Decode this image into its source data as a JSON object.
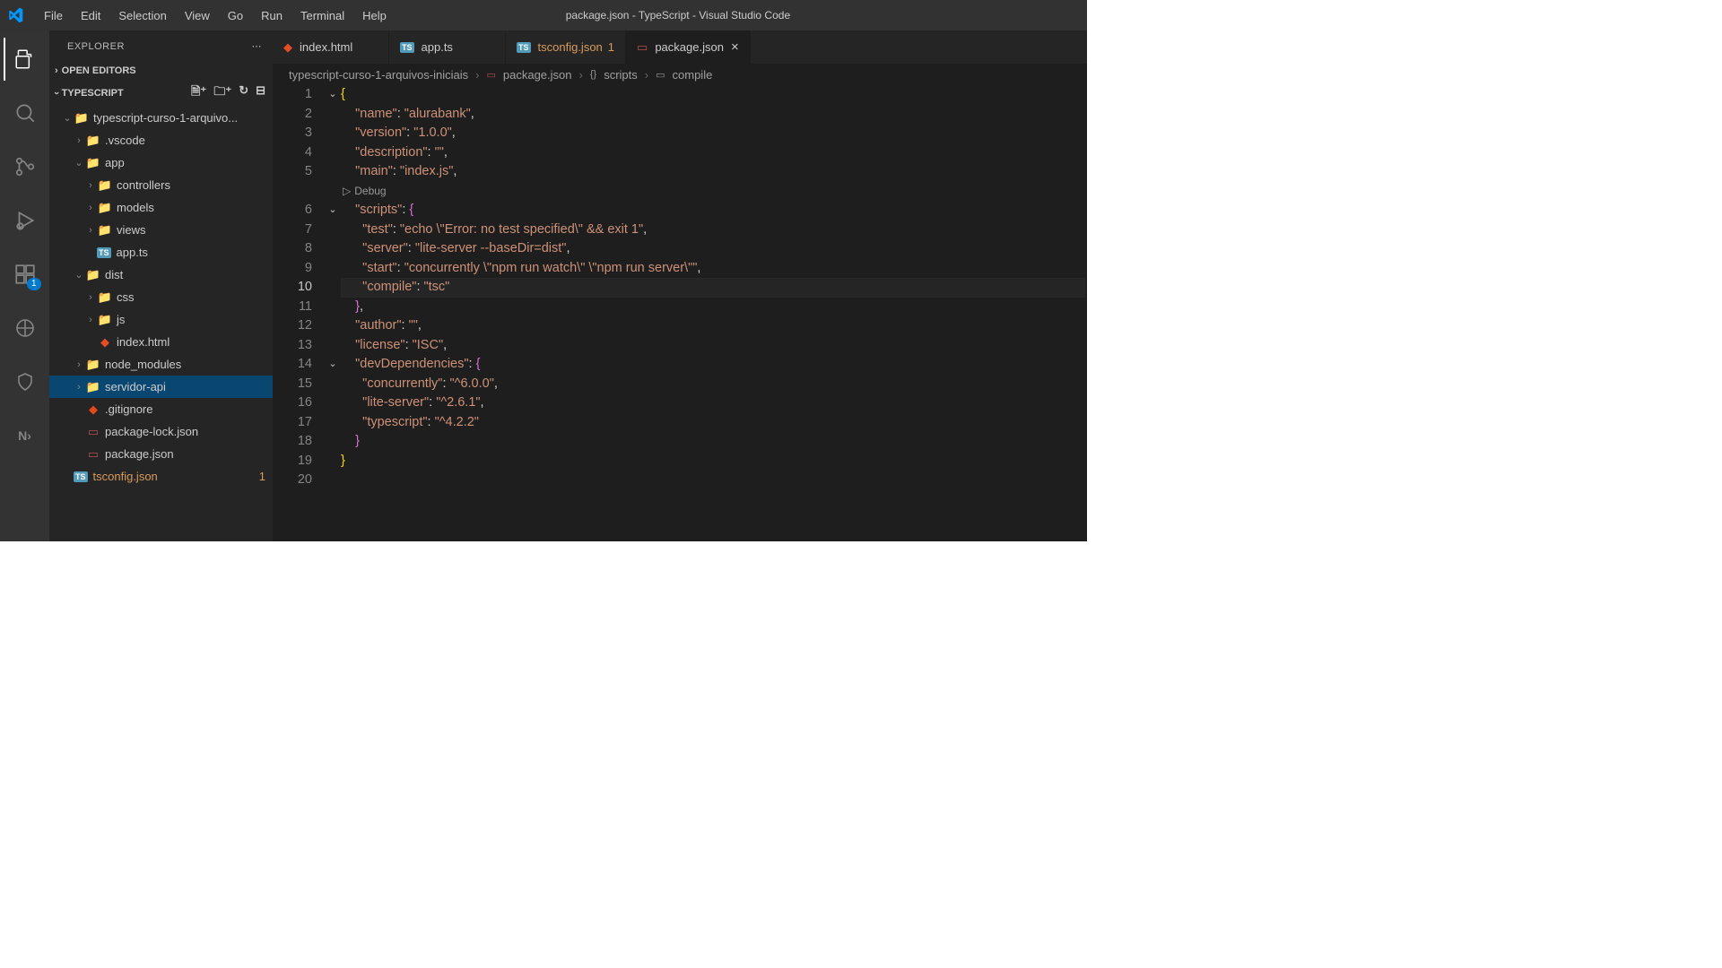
{
  "title": "package.json - TypeScript - Visual Studio Code",
  "menu": [
    "File",
    "Edit",
    "Selection",
    "View",
    "Go",
    "Run",
    "Terminal",
    "Help"
  ],
  "sidebar": {
    "title": "EXPLORER",
    "openEditors": "OPEN EDITORS",
    "workspace": "TYPESCRIPT"
  },
  "tree": [
    {
      "d": 1,
      "tw": "v",
      "icon": "📁",
      "color": "#dcb67a",
      "label": "typescript-curso-1-arquivo..."
    },
    {
      "d": 2,
      "tw": ">",
      "icon": "📁",
      "color": "#4a8fb5",
      "label": ".vscode"
    },
    {
      "d": 2,
      "tw": "v",
      "icon": "📁",
      "color": "#66bb6a",
      "label": "app"
    },
    {
      "d": 3,
      "tw": ">",
      "icon": "📁",
      "color": "#dcb67a",
      "label": "controllers"
    },
    {
      "d": 3,
      "tw": ">",
      "icon": "📁",
      "color": "#4a8fb5",
      "label": "models"
    },
    {
      "d": 3,
      "tw": ">",
      "icon": "📁",
      "color": "#ef5350",
      "label": "views"
    },
    {
      "d": 3,
      "tw": "",
      "icon": "TS",
      "color": "#519aba",
      "label": "app.ts",
      "ts": true
    },
    {
      "d": 2,
      "tw": "v",
      "icon": "📁",
      "color": "#dcb67a",
      "label": "dist"
    },
    {
      "d": 3,
      "tw": ">",
      "icon": "📁",
      "color": "#519aba",
      "label": "css"
    },
    {
      "d": 3,
      "tw": ">",
      "icon": "📁",
      "color": "#dcb67a",
      "label": "js"
    },
    {
      "d": 3,
      "tw": "",
      "icon": "◆",
      "color": "#e44d26",
      "label": "index.html"
    },
    {
      "d": 2,
      "tw": ">",
      "icon": "📁",
      "color": "#8bc34a",
      "label": "node_modules"
    },
    {
      "d": 2,
      "tw": ">",
      "icon": "📁",
      "color": "#dcb67a",
      "label": "servidor-api",
      "sel": true
    },
    {
      "d": 2,
      "tw": "",
      "icon": "◆",
      "color": "#e64a19",
      "label": ".gitignore"
    },
    {
      "d": 2,
      "tw": "",
      "icon": "▭",
      "color": "#b84f4f",
      "label": "package-lock.json"
    },
    {
      "d": 2,
      "tw": "",
      "icon": "▭",
      "color": "#b84f4f",
      "label": "package.json"
    },
    {
      "d": 1,
      "tw": "",
      "icon": "TS",
      "color": "#519aba",
      "label": "tsconfig.json",
      "mod": true,
      "suf": "1",
      "ts": true
    }
  ],
  "tabs": [
    {
      "icon": "◆",
      "ic": "#e44d26",
      "label": "index.html"
    },
    {
      "icon": "TS",
      "ic": "#519aba",
      "label": "app.ts",
      "ts": true
    },
    {
      "icon": "TS",
      "ic": "#519aba",
      "label": "tsconfig.json",
      "mod": true,
      "suf": "1",
      "ts": true
    },
    {
      "icon": "▭",
      "ic": "#b84f4f",
      "label": "package.json",
      "active": true,
      "close": true
    }
  ],
  "crumb": [
    "typescript-curso-1-arquivos-iniciais",
    "package.json",
    "scripts",
    "compile"
  ],
  "crumb_icons": [
    "",
    "▭",
    "{}",
    "▭"
  ],
  "debuglens": "Debug",
  "code": {
    "lines": [
      {
        "n": 1,
        "fold": "v",
        "seg": [
          [
            "br",
            "{"
          ]
        ]
      },
      {
        "n": 2,
        "seg": [
          [
            "p",
            "    "
          ],
          [
            "s",
            "\"name\""
          ],
          [
            "p",
            ": "
          ],
          [
            "s",
            "\"alurabank\""
          ],
          [
            "p",
            ","
          ]
        ]
      },
      {
        "n": 3,
        "seg": [
          [
            "p",
            "    "
          ],
          [
            "s",
            "\"version\""
          ],
          [
            "p",
            ": "
          ],
          [
            "s",
            "\"1.0.0\""
          ],
          [
            "p",
            ","
          ]
        ]
      },
      {
        "n": 4,
        "seg": [
          [
            "p",
            "    "
          ],
          [
            "s",
            "\"description\""
          ],
          [
            "p",
            ": "
          ],
          [
            "s",
            "\"\""
          ],
          [
            "p",
            ","
          ]
        ]
      },
      {
        "n": 5,
        "seg": [
          [
            "p",
            "    "
          ],
          [
            "s",
            "\"main\""
          ],
          [
            "p",
            ": "
          ],
          [
            "s",
            "\"index.js\""
          ],
          [
            "p",
            ","
          ]
        ]
      },
      {
        "lens": true
      },
      {
        "n": 6,
        "fold": "v",
        "seg": [
          [
            "p",
            "    "
          ],
          [
            "s",
            "\"scripts\""
          ],
          [
            "p",
            ": "
          ],
          [
            "br2",
            "{"
          ]
        ]
      },
      {
        "n": 7,
        "seg": [
          [
            "p",
            "      "
          ],
          [
            "s",
            "\"test\""
          ],
          [
            "p",
            ": "
          ],
          [
            "s",
            "\"echo \\\"Error: no test specified\\\" && exit 1\""
          ],
          [
            "p",
            ","
          ]
        ]
      },
      {
        "n": 8,
        "seg": [
          [
            "p",
            "      "
          ],
          [
            "s",
            "\"server\""
          ],
          [
            "p",
            ": "
          ],
          [
            "s",
            "\"lite-server --baseDir=dist\""
          ],
          [
            "p",
            ","
          ]
        ]
      },
      {
        "n": 9,
        "seg": [
          [
            "p",
            "      "
          ],
          [
            "s",
            "\"start\""
          ],
          [
            "p",
            ": "
          ],
          [
            "s",
            "\"concurrently \\\"npm run watch\\\" \\\"npm run server\\\"\""
          ],
          [
            "p",
            ","
          ]
        ]
      },
      {
        "n": 10,
        "cur": true,
        "seg": [
          [
            "p",
            "      "
          ],
          [
            "s",
            "\"compile\""
          ],
          [
            "p",
            ": "
          ],
          [
            "s",
            "\"tsc\""
          ]
        ]
      },
      {
        "n": 11,
        "seg": [
          [
            "p",
            "    "
          ],
          [
            "br2",
            "}"
          ],
          [
            "p",
            ","
          ]
        ]
      },
      {
        "n": 12,
        "seg": [
          [
            "p",
            "    "
          ],
          [
            "s",
            "\"author\""
          ],
          [
            "p",
            ": "
          ],
          [
            "s",
            "\"\""
          ],
          [
            "p",
            ","
          ]
        ]
      },
      {
        "n": 13,
        "seg": [
          [
            "p",
            "    "
          ],
          [
            "s",
            "\"license\""
          ],
          [
            "p",
            ": "
          ],
          [
            "s",
            "\"ISC\""
          ],
          [
            "p",
            ","
          ]
        ]
      },
      {
        "n": 14,
        "fold": "v",
        "seg": [
          [
            "p",
            "    "
          ],
          [
            "s",
            "\"devDependencies\""
          ],
          [
            "p",
            ": "
          ],
          [
            "br2",
            "{"
          ]
        ]
      },
      {
        "n": 15,
        "seg": [
          [
            "p",
            "      "
          ],
          [
            "s",
            "\"concurrently\""
          ],
          [
            "p",
            ": "
          ],
          [
            "s",
            "\"^6.0.0\""
          ],
          [
            "p",
            ","
          ]
        ]
      },
      {
        "n": 16,
        "seg": [
          [
            "p",
            "      "
          ],
          [
            "s",
            "\"lite-server\""
          ],
          [
            "p",
            ": "
          ],
          [
            "s",
            "\"^2.6.1\""
          ],
          [
            "p",
            ","
          ]
        ]
      },
      {
        "n": 17,
        "seg": [
          [
            "p",
            "      "
          ],
          [
            "s",
            "\"typescript\""
          ],
          [
            "p",
            ": "
          ],
          [
            "s",
            "\"^4.2.2\""
          ]
        ]
      },
      {
        "n": 18,
        "seg": [
          [
            "p",
            "    "
          ],
          [
            "br2",
            "}"
          ]
        ]
      },
      {
        "n": 19,
        "seg": [
          [
            "br",
            "}"
          ]
        ]
      },
      {
        "n": 20,
        "seg": [
          [
            "p",
            ""
          ]
        ]
      }
    ]
  },
  "badge_ext": "1"
}
